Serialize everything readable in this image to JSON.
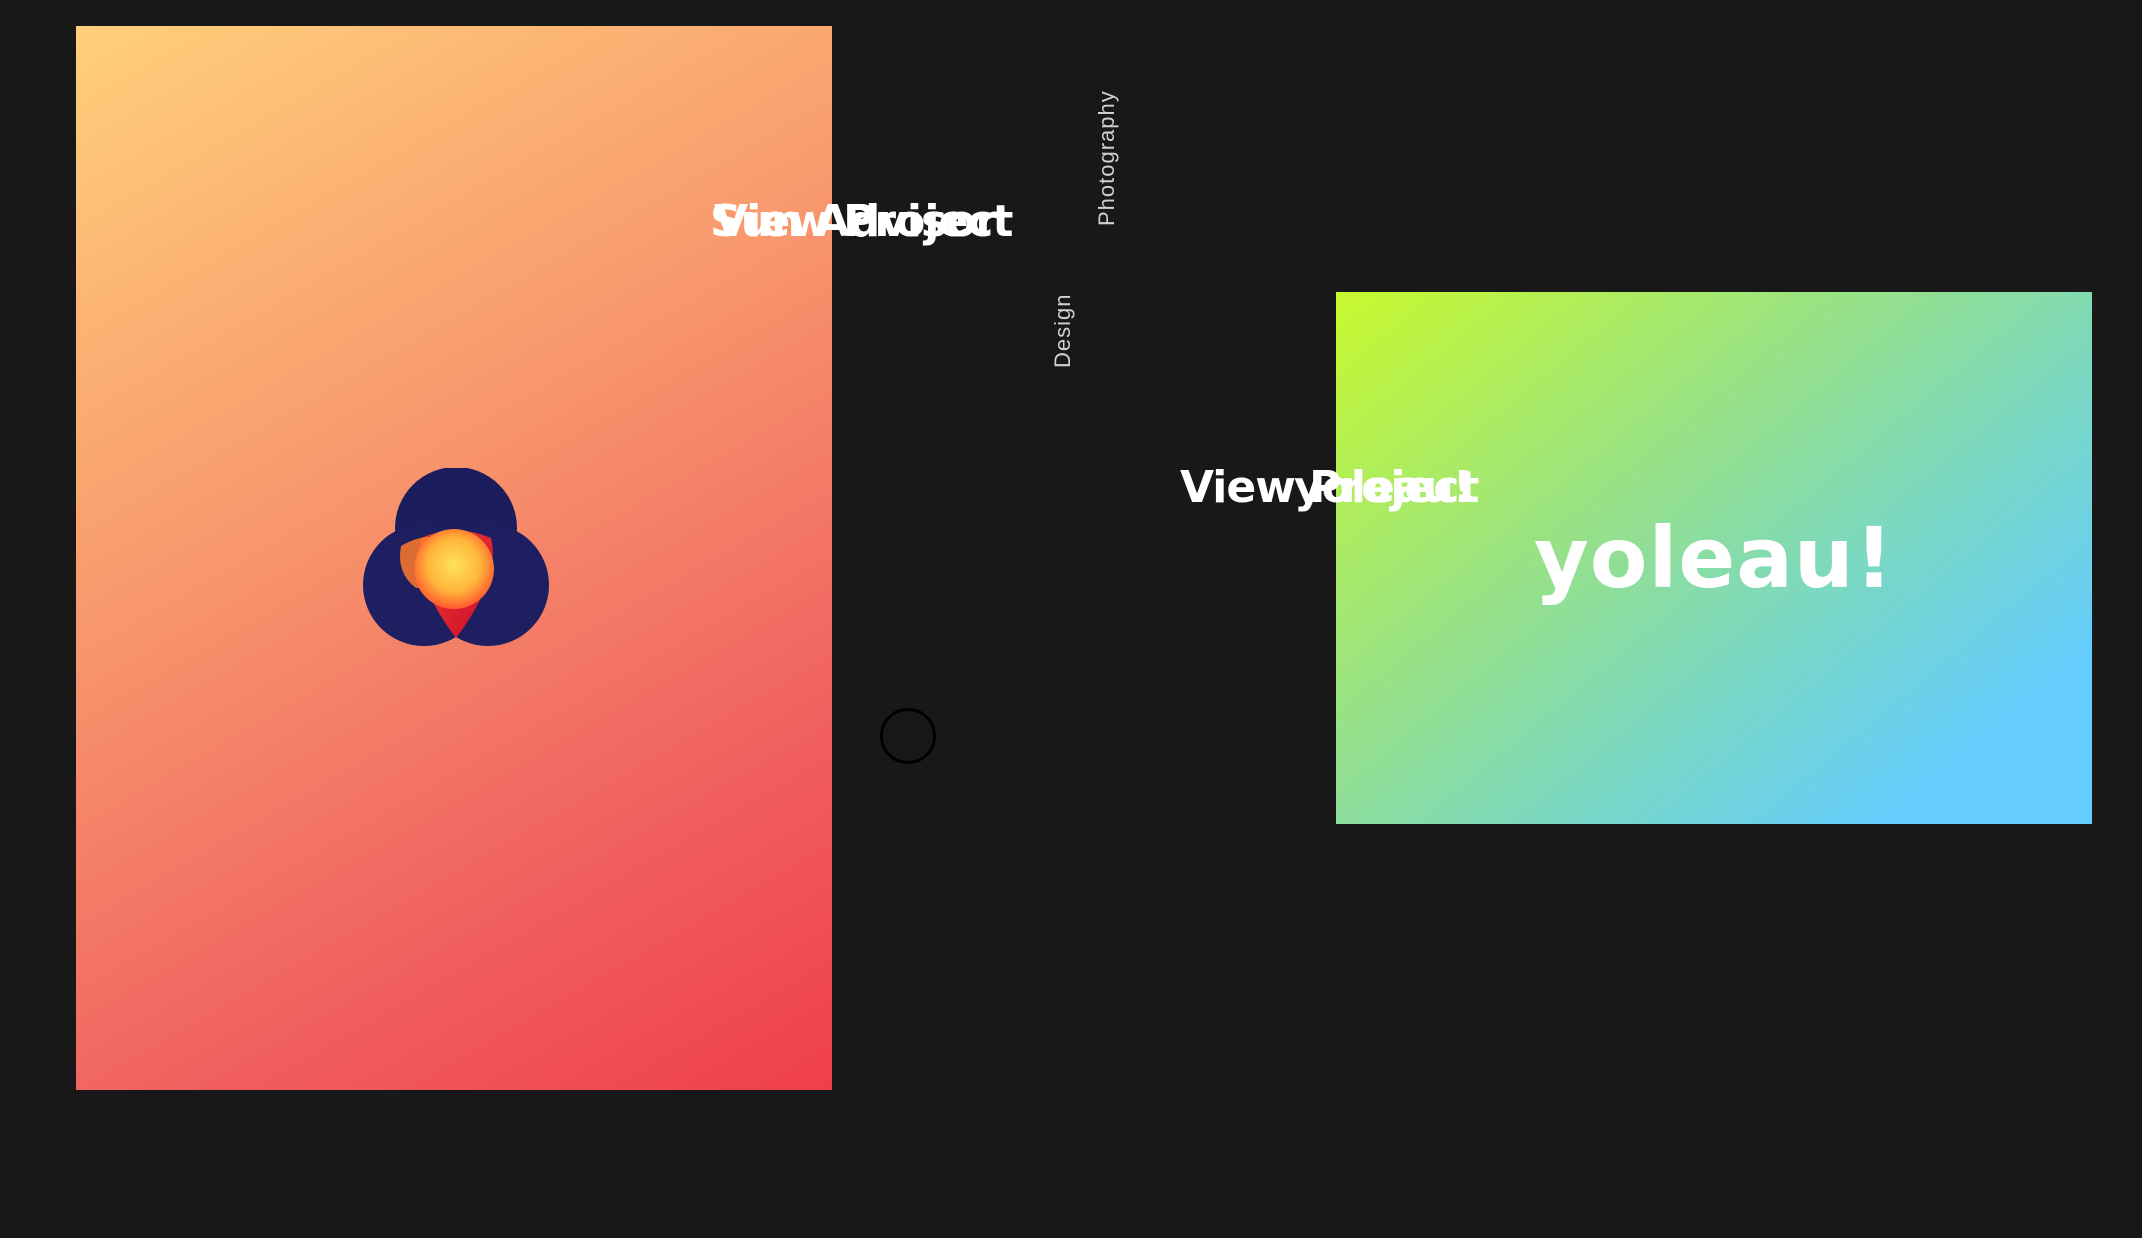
{
  "projects": {
    "left": {
      "label_primary": "View Project",
      "label_secondary": "Sun Advisor"
    },
    "right": {
      "brand": "yoleau!",
      "label_primary": "View Project",
      "label_secondary": "yoleau!"
    }
  },
  "categories": [
    {
      "label": "Photography"
    },
    {
      "label": "Design"
    }
  ],
  "colors": {
    "background": "#181818",
    "left_gradient": [
      "#ffd07b",
      "#f7916b",
      "#ef3f4a"
    ],
    "right_gradient": [
      "#c8f92e",
      "#94e08d",
      "#64ccff"
    ],
    "logo_navy": "#1b1d5c",
    "logo_red": "#e8102c"
  },
  "icons": {
    "left_logo": "overlapping-circles-logo-icon",
    "cursor": "cursor-ring-icon"
  }
}
